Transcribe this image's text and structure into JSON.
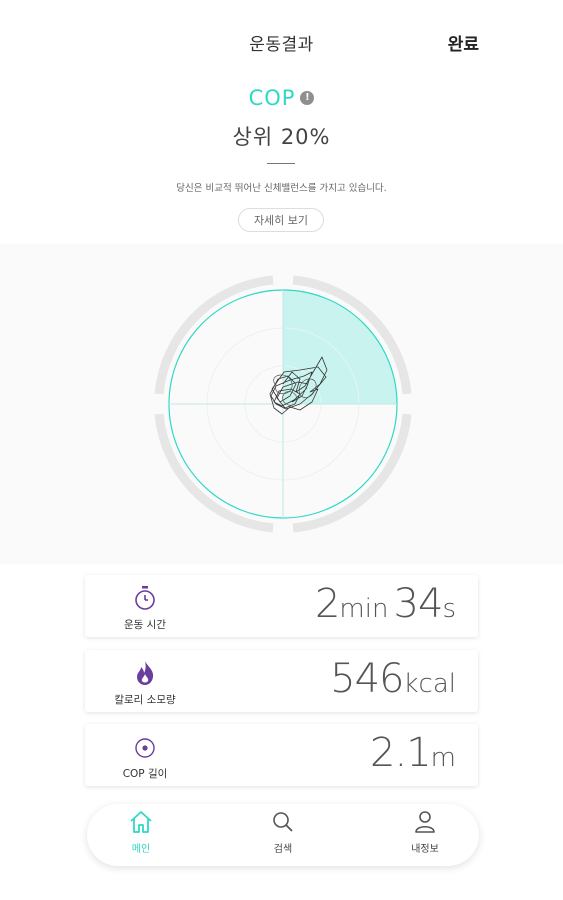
{
  "header": {
    "title": "운동결과",
    "done_label": "완료"
  },
  "cop": {
    "label": "COP",
    "info_icon": "info-icon",
    "rank": "상위 20%",
    "description": "당신은 비교적 뛰어난 신체밸런스를 가지고 있습니다.",
    "detail_button": "자세히 보기"
  },
  "colors": {
    "accent": "#2fd8c6",
    "purple": "#6a3e9e",
    "quadrant_fill": "#c9f3ee"
  },
  "stats": [
    {
      "icon": "stopwatch-icon",
      "label": "운동 시간",
      "v1": "2",
      "u1": "min",
      "v2": "34",
      "u2": "s"
    },
    {
      "icon": "fire-icon",
      "label": "칼로리 소모량",
      "v1": "546",
      "u1": "kcal"
    },
    {
      "icon": "target-icon",
      "label": "COP 길이",
      "v1": "2.1",
      "u1": "m"
    }
  ],
  "nav": [
    {
      "icon": "home-icon",
      "label": "메인",
      "active": true
    },
    {
      "icon": "search-icon",
      "label": "검색",
      "active": false
    },
    {
      "icon": "user-icon",
      "label": "내정보",
      "active": false
    }
  ]
}
